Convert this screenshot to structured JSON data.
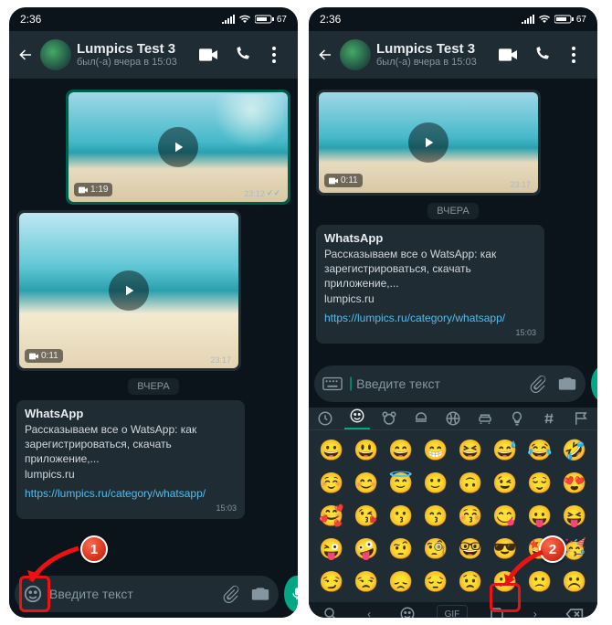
{
  "status": {
    "time": "2:36",
    "battery": "67"
  },
  "appbar": {
    "title": "Lumpics Test 3",
    "subtitle": "был(-а) вчера в 15:03"
  },
  "video1": {
    "duration": "1:19",
    "time": "23:12"
  },
  "video2": {
    "duration": "0:11",
    "time": "23:17"
  },
  "datechip": "ВЧЕРА",
  "card": {
    "title": "WhatsApp",
    "body_a": "Рассказываем все о WatsApp: как",
    "body_b": "зарегистрироваться, скачать приложение,",
    "body_c": "lumpics.ru",
    "link": "https://lumpics.ru/category/whatsapp/",
    "time": "15:03"
  },
  "input": {
    "placeholder": "Введите текст"
  },
  "right": {
    "video1": {
      "duration": "0:11",
      "time": "23:17"
    }
  },
  "gif_label": "GIF",
  "callouts": {
    "one": "1",
    "two": "2"
  },
  "emoji_rows": [
    [
      "😀",
      "😃",
      "😄",
      "😁",
      "😆",
      "😅",
      "😂",
      "🤣"
    ],
    [
      "☺️",
      "😊",
      "😇",
      "🙂",
      "🙃",
      "😉",
      "😌",
      "😍"
    ],
    [
      "🥰",
      "😘",
      "😗",
      "😙",
      "😚",
      "😋",
      "😛",
      "😝"
    ],
    [
      "😜",
      "🤪",
      "🤨",
      "🧐",
      "🤓",
      "😎",
      "🤩",
      "🥳"
    ],
    [
      "😏",
      "😒",
      "😞",
      "😔",
      "😟",
      "😕",
      "🙁",
      "☹️"
    ]
  ]
}
